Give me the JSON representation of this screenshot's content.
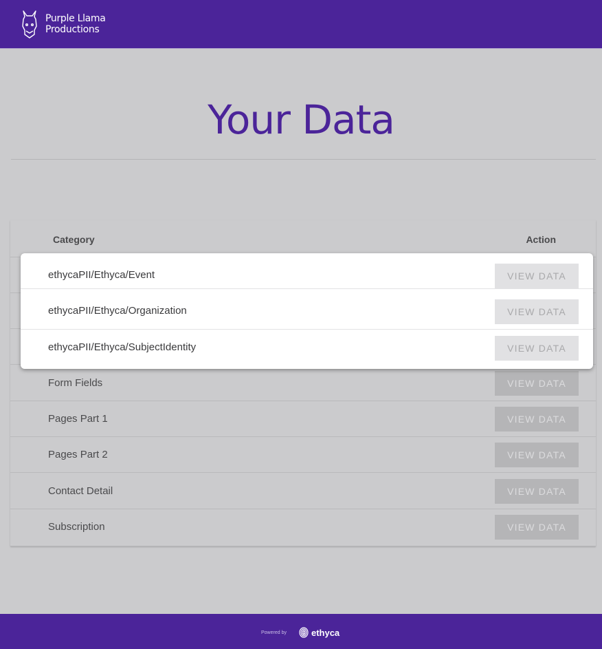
{
  "header": {
    "brand_line1": "Purple Llama",
    "brand_line2": "Productions",
    "logo_icon": "llama-icon"
  },
  "page": {
    "title": "Your Data"
  },
  "table": {
    "columns": {
      "category": "Category",
      "action": "Action"
    },
    "rows": [
      {
        "category": "ethycaPII/Ethyca/Event",
        "action_label": "VIEW DATA",
        "highlighted": true
      },
      {
        "category": "ethycaPII/Ethyca/Organization",
        "action_label": "VIEW DATA",
        "highlighted": true
      },
      {
        "category": "ethycaPII/Ethyca/SubjectIdentity",
        "action_label": "VIEW DATA",
        "highlighted": true
      },
      {
        "category": "Form Fields",
        "action_label": "VIEW DATA",
        "highlighted": false
      },
      {
        "category": "Pages Part 1",
        "action_label": "VIEW DATA",
        "highlighted": false
      },
      {
        "category": "Pages Part 2",
        "action_label": "VIEW DATA",
        "highlighted": false
      },
      {
        "category": "Contact Detail",
        "action_label": "VIEW DATA",
        "highlighted": false
      },
      {
        "category": "Subscription",
        "action_label": "VIEW DATA",
        "highlighted": false
      }
    ]
  },
  "footer": {
    "powered_by": "Powered by",
    "brand": "ethyca",
    "brand_icon": "fingerprint-icon"
  },
  "colors": {
    "brand_purple": "#4b2499",
    "page_background": "#cbcbcd",
    "highlight_surface": "#ffffff"
  }
}
